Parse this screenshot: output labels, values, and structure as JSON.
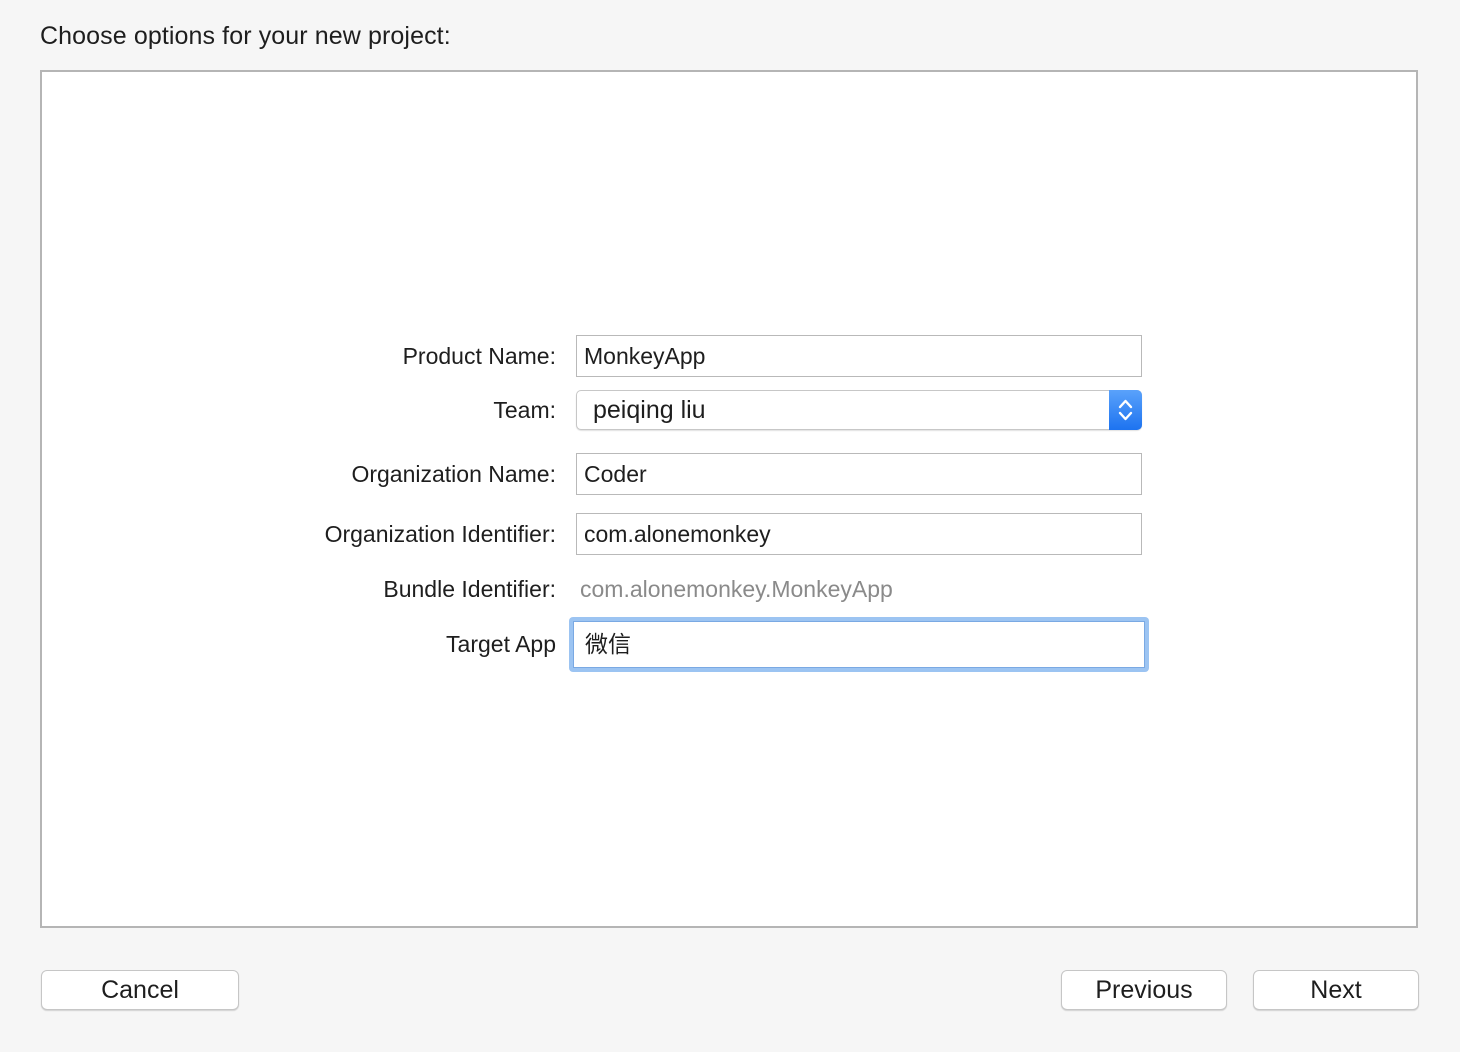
{
  "header": {
    "title": "Choose options for your new project:"
  },
  "form": {
    "product_name": {
      "label": "Product Name:",
      "value": "MonkeyApp"
    },
    "team": {
      "label": "Team:",
      "value": "peiqing liu",
      "icon": "chevron-up-down-icon"
    },
    "organization_name": {
      "label": "Organization Name:",
      "value": "Coder"
    },
    "organization_identifier": {
      "label": "Organization Identifier:",
      "value": "com.alonemonkey"
    },
    "bundle_identifier": {
      "label": "Bundle Identifier:",
      "value": "com.alonemonkey.MonkeyApp"
    },
    "target_app": {
      "label": "Target App",
      "value": "微信"
    }
  },
  "footer": {
    "cancel_label": "Cancel",
    "previous_label": "Previous",
    "next_label": "Next"
  },
  "colors": {
    "accent": "#1d73f0",
    "focus_ring": "#9cc4f2"
  }
}
